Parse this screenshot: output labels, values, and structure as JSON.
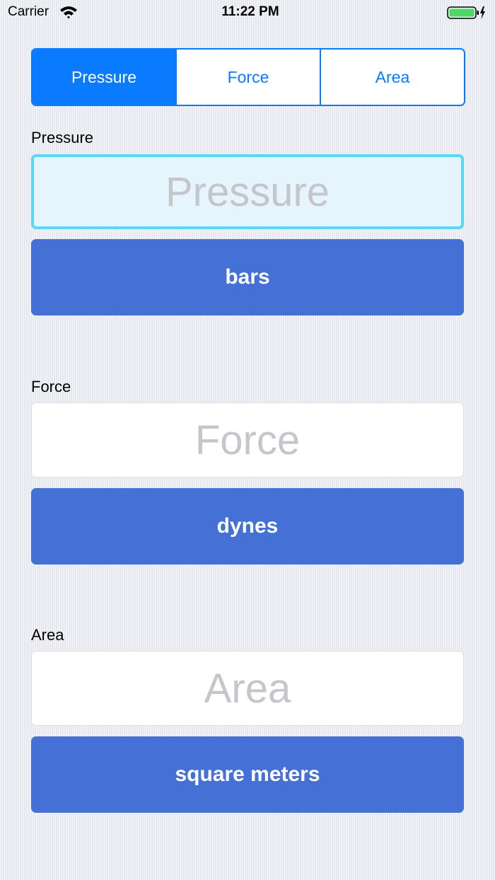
{
  "status_bar": {
    "carrier": "Carrier",
    "time": "11:22 PM",
    "wifi_icon": "wifi-icon",
    "battery_icon": "battery-charging-icon",
    "battery_color": "#4cd964"
  },
  "segmented_control": {
    "segments": [
      {
        "label": "Pressure",
        "selected": true
      },
      {
        "label": "Force",
        "selected": false
      },
      {
        "label": "Area",
        "selected": false
      }
    ],
    "accent_color": "#0a7aff"
  },
  "pressure": {
    "label": "Pressure",
    "placeholder": "Pressure",
    "value": "",
    "unit": "bars"
  },
  "force": {
    "label": "Force",
    "placeholder": "Force",
    "value": "",
    "unit": "dynes"
  },
  "area": {
    "label": "Area",
    "placeholder": "Area",
    "value": "",
    "unit": "square meters"
  },
  "colors": {
    "unit_button": "#4571d7",
    "focus_border": "#5ad7f2",
    "focus_background": "#e6f4fd"
  }
}
